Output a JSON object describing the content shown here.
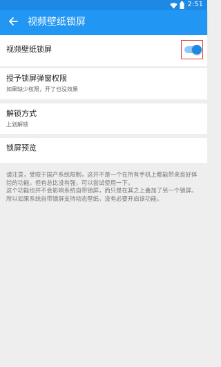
{
  "status_bar": {
    "time": "2:51",
    "icons": [
      "wifi-icon",
      "battery-icon"
    ],
    "color": "#1e88e5"
  },
  "app_bar": {
    "title": "视频壁纸锁屏",
    "back_icon": "arrow-back-icon",
    "color": "#2196f3"
  },
  "settings": {
    "video_lock": {
      "label": "视频壁纸锁屏",
      "enabled": true
    },
    "grant_popup": {
      "label": "授予锁屏弹窗权限",
      "description": "如果缺少权限，开了也没效果"
    },
    "unlock_method": {
      "label": "解锁方式",
      "value": "上划解锁"
    },
    "preview": {
      "label": "锁屏预览"
    }
  },
  "notice": {
    "text": "请注意，受限于国产系统限制，这并不是一个在所有手机上都能带来良好体验的功能。但有总比没有强，可以尝试使用一下。\n这个功能也并不会影响系统自带锁屏，而只是在其之上叠加了另一个锁屏。所以如果系统自带锁屏支持动态壁纸，没有必要开启该功能。"
  },
  "accent_color": "#1e88e5",
  "highlight_color": "#e53935"
}
